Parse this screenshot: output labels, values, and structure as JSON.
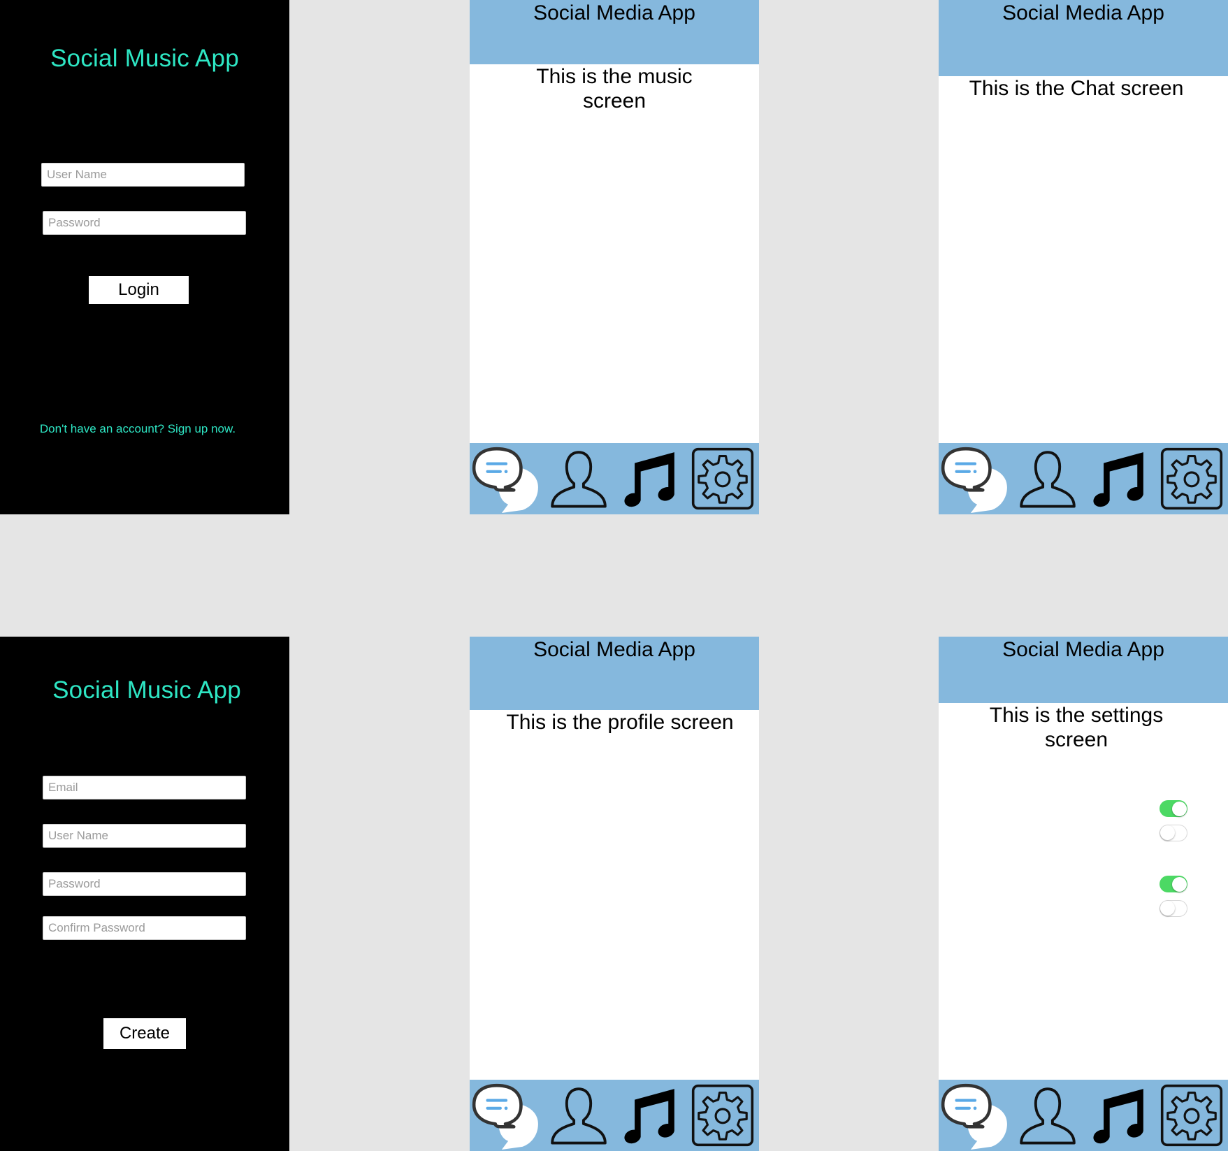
{
  "login": {
    "title": "Social Music App",
    "username_placeholder": "User Name",
    "password_placeholder": "Password",
    "login_label": "Login",
    "signup_text": "Don't have an account? Sign up now."
  },
  "signup": {
    "title": "Social Music App",
    "email_placeholder": "Email",
    "username_placeholder": "User Name",
    "password_placeholder": "Password",
    "confirm_placeholder": "Confirm Password",
    "create_label": "Create"
  },
  "app_title": "Social Media App",
  "music_screen": {
    "text": "This is the music screen"
  },
  "chat_screen": {
    "text": "This is the Chat screen"
  },
  "profile_screen": {
    "text": "This is the profile screen"
  },
  "settings_screen": {
    "text": "This is the settings screen",
    "toggles": [
      true,
      false,
      true,
      false
    ]
  },
  "nav_icons": [
    "chat-icon",
    "profile-icon",
    "music-note-icon",
    "gear-icon"
  ],
  "colors": {
    "accent": "#2ee6c4",
    "header": "#85b8dd",
    "toggle_on": "#4cd964"
  }
}
